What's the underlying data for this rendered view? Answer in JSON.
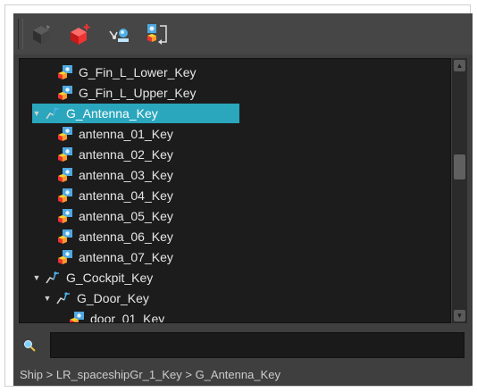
{
  "toolbar": {
    "buttons": [
      {
        "icon": "cube-icon"
      },
      {
        "icon": "add-red-cube-icon"
      },
      {
        "icon": "peg-link-icon"
      },
      {
        "icon": "node-swap-icon"
      }
    ]
  },
  "tree": {
    "rows": [
      {
        "label": "G_Fin_L_Lower_Key",
        "type": "drawing",
        "expanded": null,
        "selected": false
      },
      {
        "label": "G_Fin_L_Upper_Key",
        "type": "drawing",
        "expanded": null,
        "selected": false
      },
      {
        "label": "G_Antenna_Key",
        "type": "group",
        "expanded": true,
        "selected": true
      },
      {
        "label": "antenna_01_Key",
        "type": "drawing",
        "expanded": null,
        "selected": false
      },
      {
        "label": "antenna_02_Key",
        "type": "drawing",
        "expanded": null,
        "selected": false
      },
      {
        "label": "antenna_03_Key",
        "type": "drawing",
        "expanded": null,
        "selected": false
      },
      {
        "label": "antenna_04_Key",
        "type": "drawing",
        "expanded": null,
        "selected": false
      },
      {
        "label": "antenna_05_Key",
        "type": "drawing",
        "expanded": null,
        "selected": false
      },
      {
        "label": "antenna_06_Key",
        "type": "drawing",
        "expanded": null,
        "selected": false
      },
      {
        "label": "antenna_07_Key",
        "type": "drawing",
        "expanded": null,
        "selected": false
      },
      {
        "label": "G_Cockpit_Key",
        "type": "group",
        "expanded": true,
        "selected": false
      },
      {
        "label": "G_Door_Key",
        "type": "group",
        "expanded": true,
        "selected": false
      },
      {
        "label": "door_01_Key",
        "type": "drawing",
        "expanded": null,
        "selected": false
      }
    ]
  },
  "search": {
    "value": "",
    "placeholder": ""
  },
  "breadcrumb": "Ship > LR_spaceshipGr_1_Key > G_Antenna_Key",
  "colors": {
    "selection": "#2aa6bd",
    "panel": "#3f3f3f",
    "tree_bg": "#1c1c1c"
  }
}
